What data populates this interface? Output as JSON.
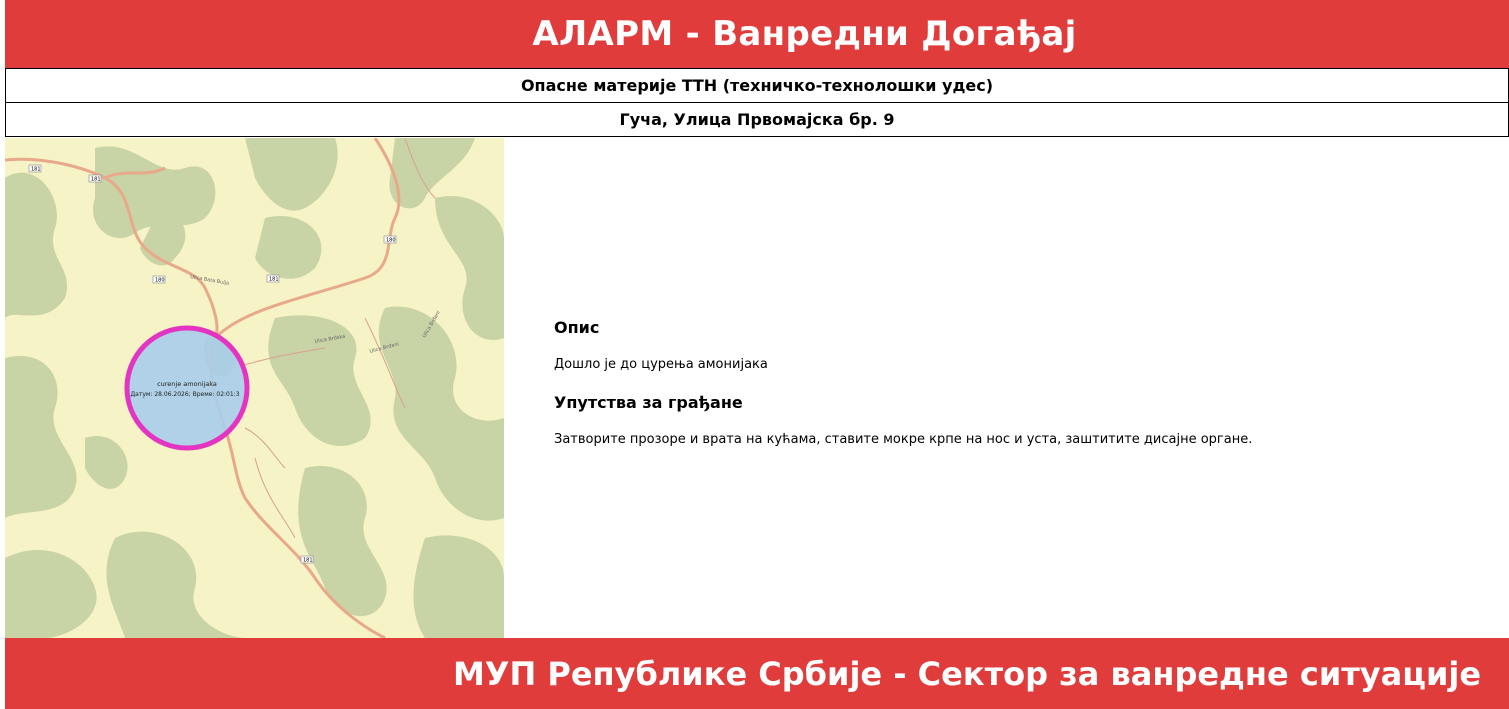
{
  "header": {
    "title": "АЛАРМ - Ванредни Догађај"
  },
  "incident": {
    "type": "Опасне материје ТТН (техничко-технолошки удес)",
    "address": "Гуча, Улица Првомајска бр. 9"
  },
  "map": {
    "marker_label": "curenje amonijaka",
    "marker_sub": "Датум: 28.06.2026; Време: 02:01:3",
    "road_labels": [
      "181",
      "181",
      "180",
      "181",
      "180",
      "181"
    ],
    "street_labels": [
      "Ulica Bata Bulja",
      "Ulica Brdska",
      "Ulica Brđani",
      "Ulica Brđani"
    ],
    "colors": {
      "land": "#f6f3c6",
      "forest": "#c9d4a6",
      "road": "#e8a98a",
      "circle_fill": "#a8cdea",
      "circle_stroke": "#e335c2"
    }
  },
  "details": {
    "description_heading": "Опис",
    "description_text": "Дошло је до цурења амонијака",
    "instructions_heading": "Упутства за грађане",
    "instructions_text": "Затворите прозоре и врата на кућама, ставите мокре крпе на нос и уста, заштитите дисајне органе."
  },
  "footer": {
    "title": "МУП Републике Србије - Сектор за ванредне ситуације"
  },
  "colors": {
    "accent": "#e03c3c"
  }
}
